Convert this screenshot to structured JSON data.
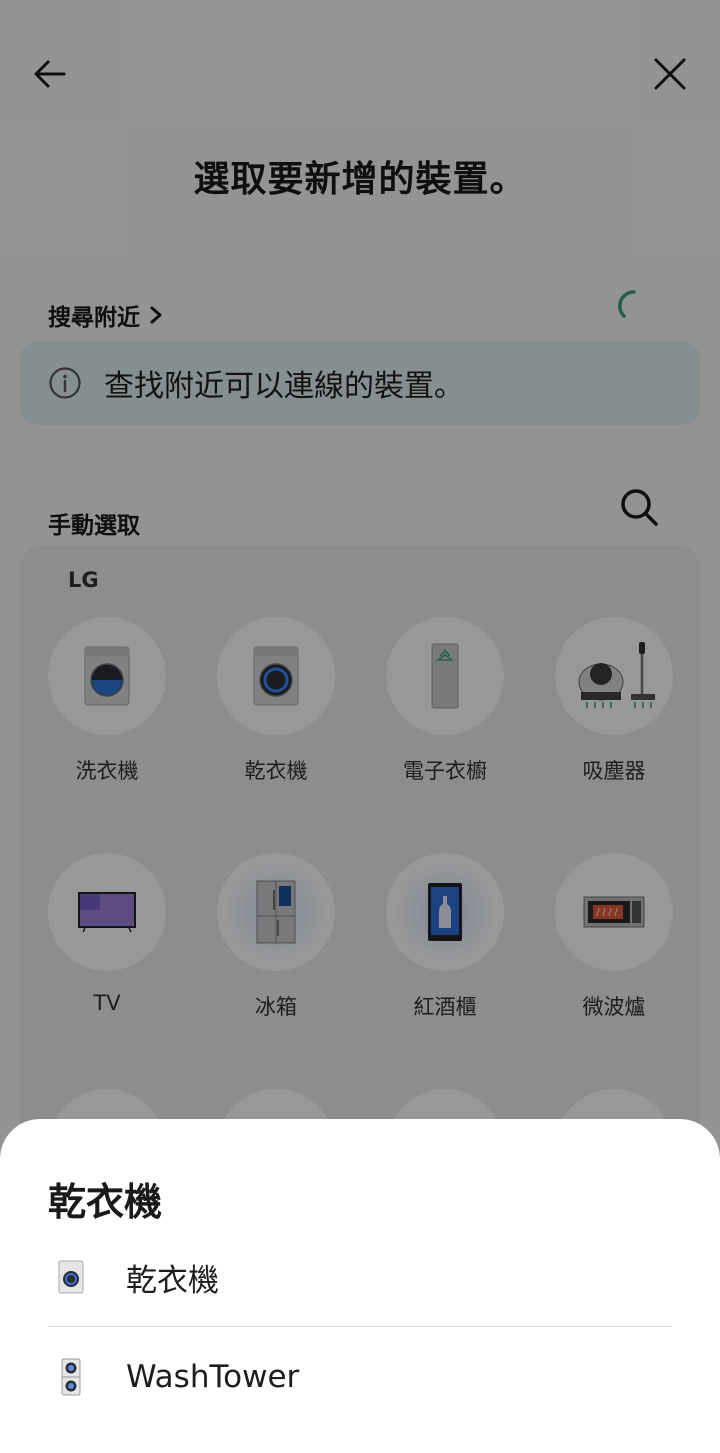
{
  "header": {
    "title": "選取要新增的裝置。"
  },
  "nearby": {
    "label": "搜尋附近",
    "info": "查找附近可以連線的裝置。"
  },
  "manual": {
    "label": "手動選取",
    "brand": "LG",
    "devices": [
      {
        "label": "洗衣機",
        "icon": "washer-icon"
      },
      {
        "label": "乾衣機",
        "icon": "dryer-icon"
      },
      {
        "label": "電子衣櫥",
        "icon": "styler-icon"
      },
      {
        "label": "吸塵器",
        "icon": "vacuum-icon"
      },
      {
        "label": "TV",
        "icon": "tv-icon"
      },
      {
        "label": "冰箱",
        "icon": "refrigerator-icon"
      },
      {
        "label": "紅酒櫃",
        "icon": "wine-cellar-icon"
      },
      {
        "label": "微波爐",
        "icon": "microwave-icon"
      }
    ]
  },
  "sheet": {
    "title": "乾衣機",
    "items": [
      {
        "label": "乾衣機",
        "icon": "dryer-icon"
      },
      {
        "label": "WashTower",
        "icon": "washtower-icon"
      }
    ]
  },
  "colors": {
    "accent": "#3aa07a",
    "info_bg": "#dfeeee",
    "overlay": "rgba(0,0,0,0.40)"
  }
}
